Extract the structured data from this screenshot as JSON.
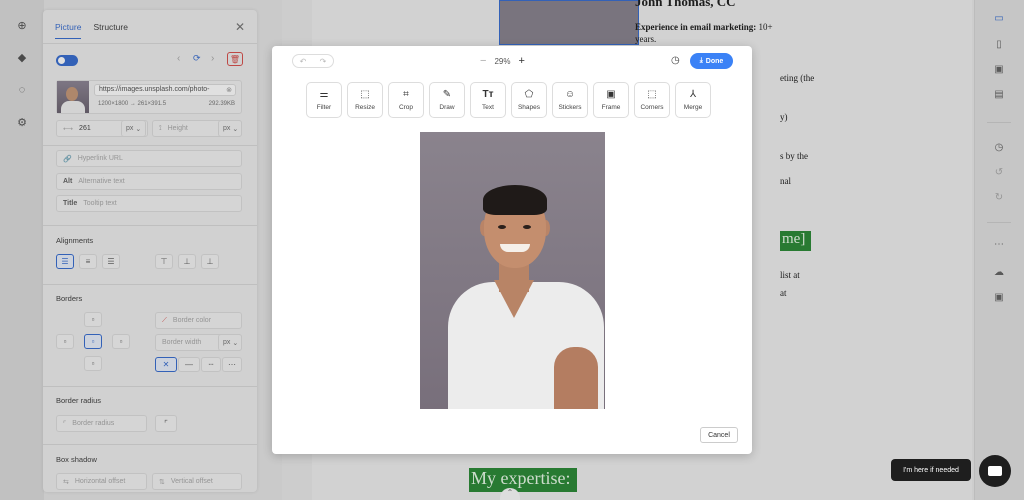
{
  "left_panel": {
    "tabs": [
      "Picture",
      "Structure"
    ],
    "image": {
      "url": "https://images.unsplash.com/photo-",
      "dimensions": "1200×1800 → 261×391.5",
      "size": "292.39KB"
    },
    "width": {
      "value": "261",
      "unit": "px"
    },
    "height": {
      "placeholder": "Height",
      "unit": "px"
    },
    "hyperlink_placeholder": "Hyperlink URL",
    "alt_label": "Alt",
    "alt_placeholder": "Alternative text",
    "title_label": "Title",
    "title_placeholder": "Tooltip text",
    "alignments_label": "Alignments",
    "borders_label": "Borders",
    "border_color_placeholder": "Border color",
    "border_width_placeholder": "Border width",
    "border_width_unit": "px",
    "border_radius_label": "Border radius",
    "border_radius_placeholder": "Border radius",
    "box_shadow_label": "Box shadow",
    "h_offset_placeholder": "Horizontal offset",
    "v_offset_placeholder": "Vertical offset"
  },
  "document": {
    "heading": "John Thomas, CC",
    "line1_bold": "Experience in email marketing:",
    "line1_rest": " 10+",
    "line2": "years.",
    "line3": "eting (the",
    "line4": "y)",
    "line5": "s by the",
    "line6": "nal",
    "green_word": "me]",
    "line7": "list at",
    "line8": "at",
    "expertise": "My expertise:"
  },
  "editor": {
    "zoom": "29%",
    "done_label": "Done",
    "cancel_label": "Cancel",
    "tools": [
      {
        "label": "Filter",
        "icon": "filter-icon"
      },
      {
        "label": "Resize",
        "icon": "resize-icon"
      },
      {
        "label": "Crop",
        "icon": "crop-icon"
      },
      {
        "label": "Draw",
        "icon": "draw-icon"
      },
      {
        "label": "Text",
        "icon": "text-icon"
      },
      {
        "label": "Shapes",
        "icon": "shapes-icon"
      },
      {
        "label": "Stickers",
        "icon": "stickers-icon"
      },
      {
        "label": "Frame",
        "icon": "frame-icon"
      },
      {
        "label": "Corners",
        "icon": "corners-icon"
      },
      {
        "label": "Merge",
        "icon": "merge-icon"
      }
    ]
  },
  "chat": {
    "bubble": "I'm here if needed"
  },
  "colors": {
    "accent": "#3b82f6",
    "doc_green": "#2e8b3a",
    "danger": "#d9534f"
  }
}
